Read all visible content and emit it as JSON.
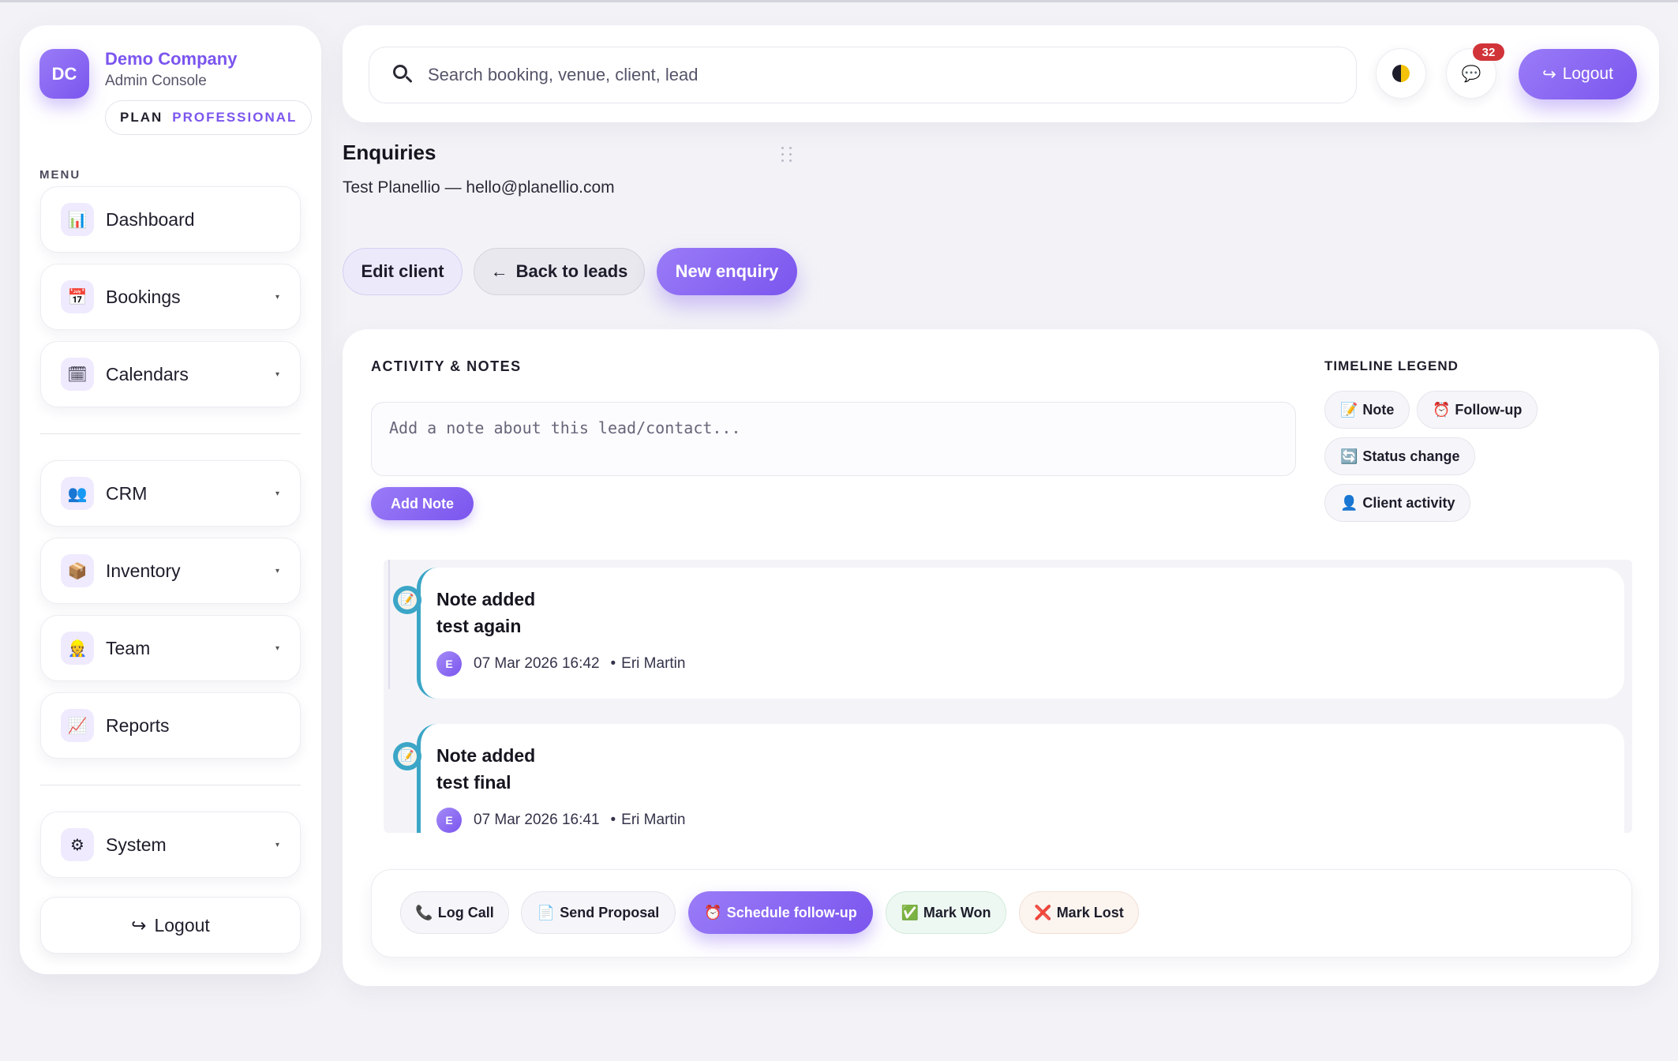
{
  "brand": {
    "initials": "DC",
    "name": "Demo Company",
    "subtitle": "Admin Console",
    "plan_key": "PLAN",
    "plan_value": "PROFESSIONAL"
  },
  "menu": {
    "label": "MENU",
    "items": [
      {
        "label": "Dashboard",
        "icon": "bar-chart-icon",
        "glyph": "📊"
      },
      {
        "label": "Bookings",
        "icon": "calendar-icon",
        "glyph": "📅"
      },
      {
        "label": "Calendars",
        "icon": "calendar-pencil-icon",
        "glyph": "🗓"
      },
      {
        "label": "CRM",
        "icon": "people-icon",
        "glyph": "👥"
      },
      {
        "label": "Inventory",
        "icon": "box-icon",
        "glyph": "📦"
      },
      {
        "label": "Team",
        "icon": "team-member-icon",
        "glyph": "👷"
      },
      {
        "label": "Reports",
        "icon": "trend-chart-icon",
        "glyph": "📈"
      },
      {
        "label": "System",
        "icon": "gear-icon",
        "glyph": "⚙"
      }
    ],
    "caret": "▾",
    "logout": "Logout",
    "logout_glyph": "↪"
  },
  "topbar": {
    "search_placeholder": "Search booking, venue, client, lead",
    "notification_count": "32",
    "logout": "Logout",
    "logout_glyph": "↪",
    "chat_glyph": "💬"
  },
  "page": {
    "title": "Enquiries",
    "subtitle": "Test Planellio — hello@planellio.com",
    "buttons": {
      "edit": "Edit client",
      "back": "Back to leads",
      "back_glyph": "←",
      "new": "New enquiry"
    }
  },
  "activity": {
    "title": "ACTIVITY & NOTES",
    "note_placeholder": "Add a note about this lead/contact...",
    "add_note": "Add Note",
    "legend_title": "TIMELINE LEGEND",
    "legend": [
      {
        "glyph": "📝",
        "label": "Note"
      },
      {
        "glyph": "⏰",
        "label": "Follow-up"
      },
      {
        "glyph": "🔄",
        "label": "Status change"
      },
      {
        "glyph": "👤",
        "label": "Client activity"
      }
    ],
    "entries": [
      {
        "glyph": "📝",
        "title": "Note added",
        "body": "test again",
        "avatar": "E",
        "time": "07 Mar 2026 16:42",
        "bullet": "•",
        "author": "Eri Martin"
      },
      {
        "glyph": "📝",
        "title": "Note added",
        "body": "test final",
        "avatar": "E",
        "time": "07 Mar 2026 16:41",
        "bullet": "•",
        "author": "Eri Martin"
      }
    ],
    "actions": [
      {
        "glyph": "📞",
        "label": "Log Call"
      },
      {
        "glyph": "📄",
        "label": "Send Proposal"
      },
      {
        "glyph": "⏰",
        "label": "Schedule follow-up"
      },
      {
        "glyph": "✅",
        "label": "Mark Won"
      },
      {
        "glyph": "❌",
        "label": "Mark Lost"
      }
    ]
  },
  "colors": {
    "accent": "#7b55ee",
    "timeline": "#3ba6c7",
    "badge": "#d13438"
  }
}
